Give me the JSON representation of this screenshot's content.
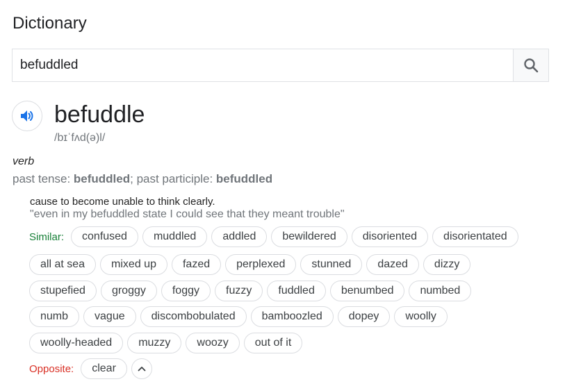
{
  "header": {
    "title": "Dictionary"
  },
  "search": {
    "value": "befuddled"
  },
  "entry": {
    "word": "befuddle",
    "phonetic": "/bɪˈfʌd(ə)l/",
    "part_of_speech": "verb",
    "forms": {
      "past_tense_label": "past tense: ",
      "past_tense": "befuddled",
      "separator": "; ",
      "past_participle_label": "past participle: ",
      "past_participle": "befuddled"
    },
    "definition": "cause to become unable to think clearly.",
    "example": "\"even in my befuddled state I could see that they meant trouble\"",
    "similar_label": "Similar:",
    "similar_rows": [
      [
        "confused",
        "muddled",
        "addled",
        "bewildered",
        "disoriented",
        "disorientated"
      ],
      [
        "all at sea",
        "mixed up",
        "fazed",
        "perplexed",
        "stunned",
        "dazed",
        "dizzy"
      ],
      [
        "stupefied",
        "groggy",
        "foggy",
        "fuzzy",
        "fuddled",
        "benumbed",
        "numbed"
      ],
      [
        "numb",
        "vague",
        "discombobulated",
        "bamboozled",
        "dopey",
        "woolly"
      ],
      [
        "woolly-headed",
        "muzzy",
        "woozy",
        "out of it"
      ]
    ],
    "opposite_label": "Opposite:",
    "opposite": [
      "clear"
    ]
  },
  "icons": {
    "search": "search-icon",
    "speaker": "speaker-icon",
    "collapse": "chevron-up-icon"
  },
  "colors": {
    "similar_label": "#188038",
    "opposite_label": "#d93025",
    "speaker": "#1a73e8",
    "search_icon": "#5f6368"
  }
}
